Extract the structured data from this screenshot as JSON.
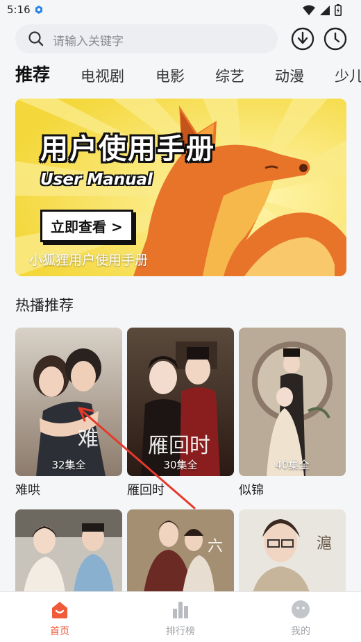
{
  "status_bar": {
    "time": "5:16"
  },
  "search": {
    "placeholder": "请输入关键字"
  },
  "tabs": [
    {
      "label": "推荐",
      "active": true
    },
    {
      "label": "电视剧"
    },
    {
      "label": "电影"
    },
    {
      "label": "综艺"
    },
    {
      "label": "动漫"
    },
    {
      "label": "少儿"
    }
  ],
  "banner": {
    "title": "用户使用手册",
    "subtitle": "User Manual",
    "button": "立即查看 >",
    "caption": "小狐狸用户使用手册"
  },
  "section": {
    "title": "热播推荐"
  },
  "cards": [
    {
      "title": "难哄",
      "episodes": "32集全"
    },
    {
      "title": "雁回时",
      "episodes": "30集全"
    },
    {
      "title": "似锦",
      "episodes": "40集全"
    }
  ],
  "bottom_nav": [
    {
      "label": "首页",
      "active": true
    },
    {
      "label": "排行榜"
    },
    {
      "label": "我的"
    }
  ],
  "colors": {
    "accent": "#f05a3a",
    "banner_bg": "#f6df47",
    "fox": "#e8742a"
  }
}
